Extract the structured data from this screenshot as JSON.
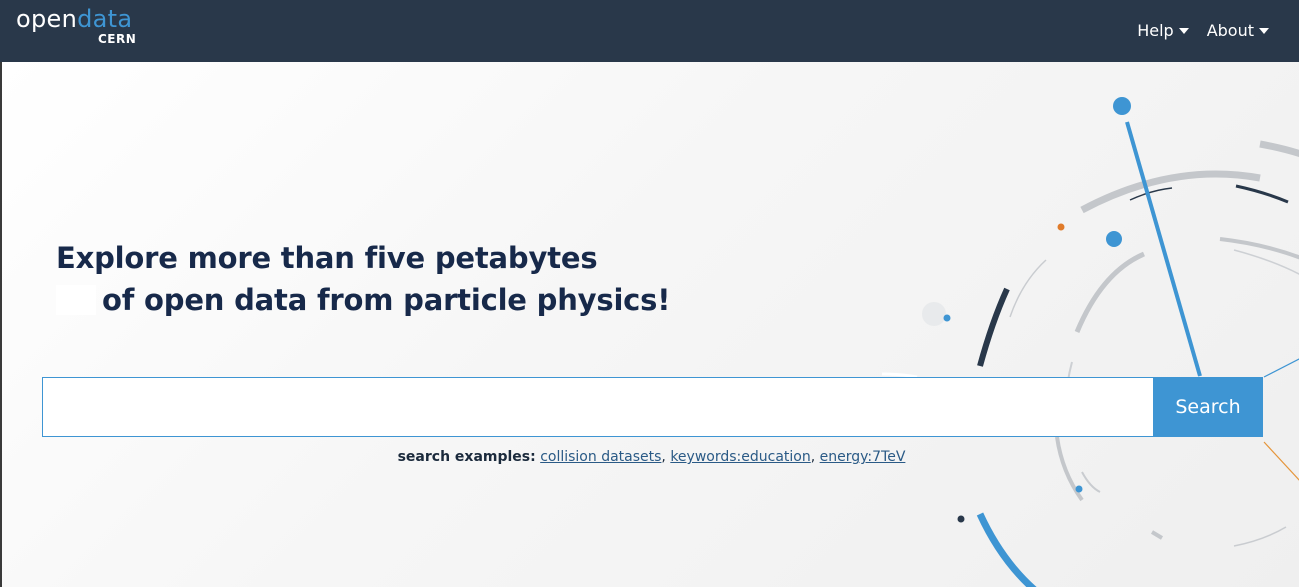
{
  "navbar": {
    "logo": {
      "open": "open",
      "data": "data",
      "sub": "CERN"
    },
    "menu": [
      {
        "label": "Help"
      },
      {
        "label": "About"
      }
    ]
  },
  "hero": {
    "headline_prefix": "Explore more than ",
    "headline_bold": "five petabytes",
    "headline_line2": "of open data from particle physics!"
  },
  "search": {
    "value": "",
    "placeholder": "",
    "button_label": "Search",
    "examples_label": "search examples:",
    "examples": [
      {
        "label": "collision datasets"
      },
      {
        "label": "keywords:education"
      },
      {
        "label": "energy:7TeV"
      }
    ]
  },
  "colors": {
    "navbar": "#29384a",
    "accent": "#3e95d3",
    "headline": "#17294a"
  }
}
